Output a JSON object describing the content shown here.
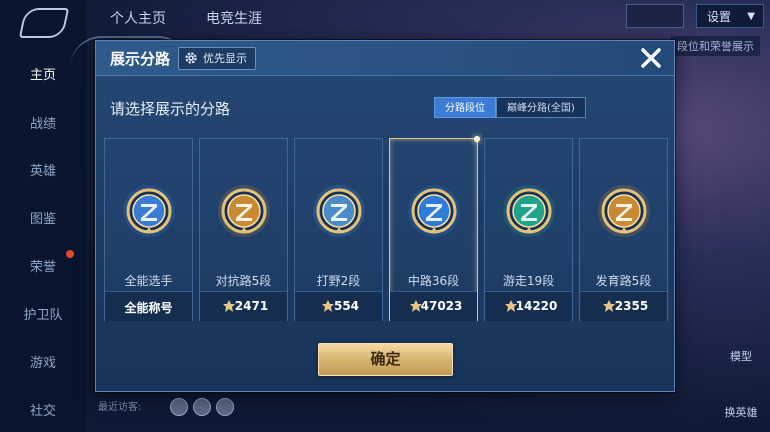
{
  "background": {
    "nav_items": [
      "主页",
      "战绩",
      "英雄",
      "图鉴",
      "荣誉",
      "护卫队",
      "游戏",
      "社交"
    ],
    "top_tabs": [
      "个人主页",
      "电竞生涯"
    ],
    "settings_label": "设置",
    "right_link": "段位和荣誉展示",
    "right_labels": [
      "模型",
      "换英雄"
    ],
    "recent_visitors": "最近访客:"
  },
  "modal": {
    "title": "展示分路",
    "priority_label": "优先显示",
    "subtitle": "请选择展示的分路",
    "segments": [
      "分路段位",
      "巅峰分路(全国)"
    ],
    "active_segment": 0,
    "confirm_label": "确定",
    "cards": [
      {
        "label": "全能选手",
        "value": "全能称号",
        "show_points_icon": false,
        "badge_icon": "all-round-badge-icon",
        "badge_color": "#3a7bd5",
        "selected": false
      },
      {
        "label": "对抗路5段",
        "value": "2471",
        "show_points_icon": true,
        "badge_icon": "clash-lane-badge-icon",
        "badge_color": "#c98a32",
        "selected": false
      },
      {
        "label": "打野2段",
        "value": "554",
        "show_points_icon": true,
        "badge_icon": "jungle-badge-icon",
        "badge_color": "#4a8cc8",
        "selected": false
      },
      {
        "label": "中路36段",
        "value": "47023",
        "show_points_icon": true,
        "badge_icon": "mid-lane-badge-icon",
        "badge_color": "#2e7bd8",
        "selected": true
      },
      {
        "label": "游走19段",
        "value": "14220",
        "show_points_icon": true,
        "badge_icon": "roam-badge-icon",
        "badge_color": "#1fa38a",
        "selected": false
      },
      {
        "label": "发育路5段",
        "value": "2355",
        "show_points_icon": true,
        "badge_icon": "farm-lane-badge-icon",
        "badge_color": "#c98a32",
        "selected": false
      }
    ]
  },
  "colors": {
    "accent_blue": "#3b7dd6",
    "gold": "#d8b470",
    "selected_border": "#e6c487"
  }
}
